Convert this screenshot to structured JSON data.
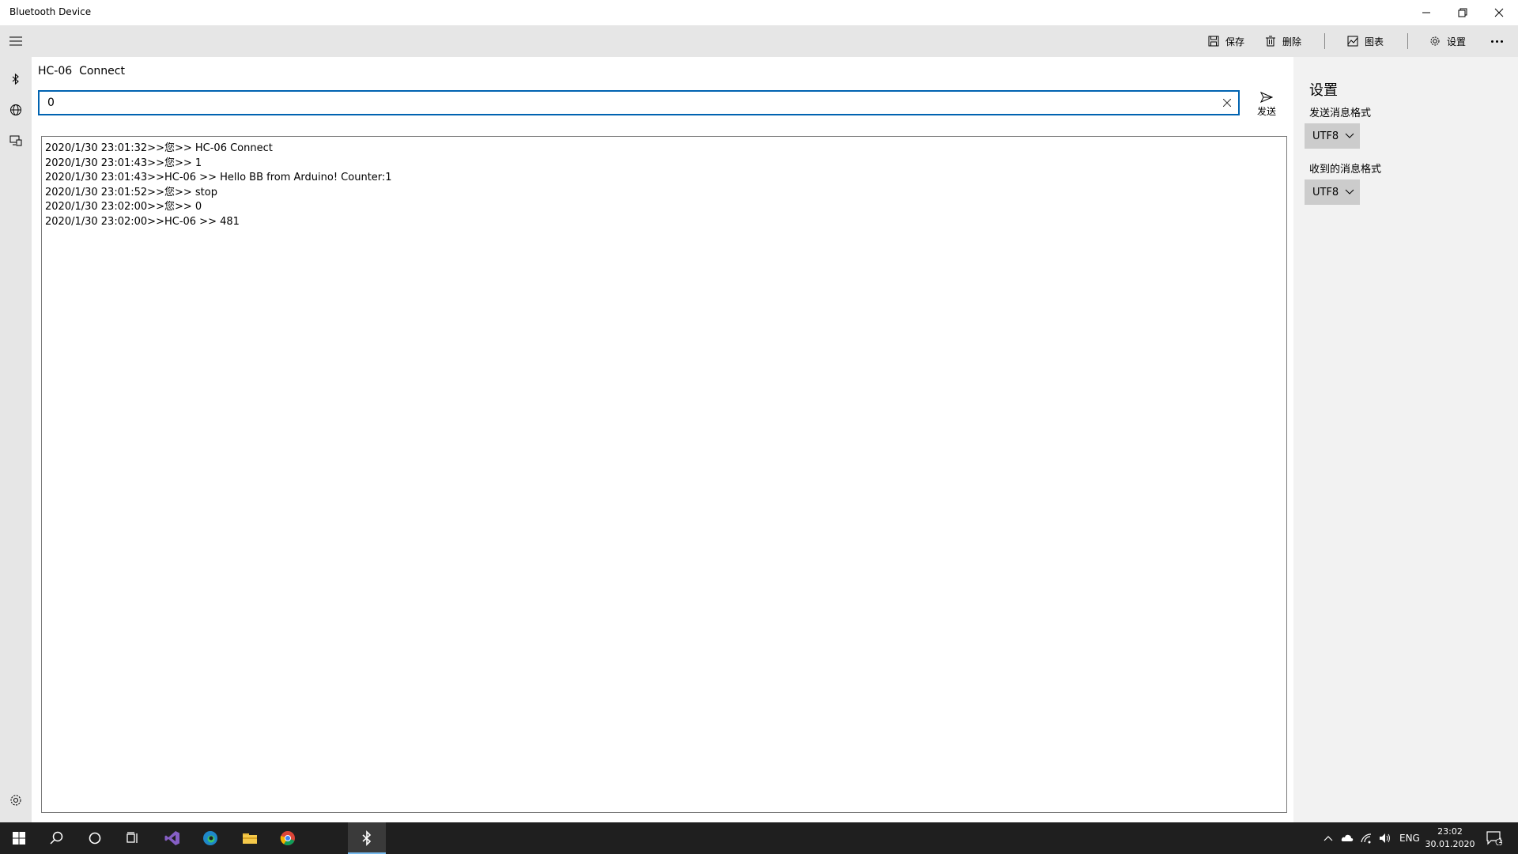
{
  "window": {
    "title": "Bluetooth Device"
  },
  "toolbar": {
    "save_label": "保存",
    "delete_label": "删除",
    "chart_label": "图表",
    "settings_label": "设置"
  },
  "device": {
    "name": "HC-06",
    "status": "Connect"
  },
  "message_input": {
    "value": "0",
    "send_label": "发送"
  },
  "log": {
    "lines": [
      "2020/1/30 23:01:32>>您>> HC-06 Connect",
      "2020/1/30 23:01:43>>您>> 1",
      "2020/1/30 23:01:43>>HC-06 >> Hello BB from Arduino! Counter:1",
      "2020/1/30 23:01:52>>您>> stop",
      "2020/1/30 23:02:00>>您>> 0",
      "2020/1/30 23:02:00>>HC-06 >> 481"
    ]
  },
  "settings_panel": {
    "title": "设置",
    "send_format_label": "发送消息格式",
    "send_format_value": "UTF8",
    "receive_format_label": "收到的消息格式",
    "receive_format_value": "UTF8"
  },
  "taskbar": {
    "language": "ENG",
    "time": "23:02",
    "date": "30.01.2020",
    "notification_count": "1"
  },
  "colors": {
    "accent": "#0063b1",
    "chrome": "#e6e6e6",
    "settings_bg": "#f2f2f2",
    "taskbar": "#1f1f1f"
  }
}
